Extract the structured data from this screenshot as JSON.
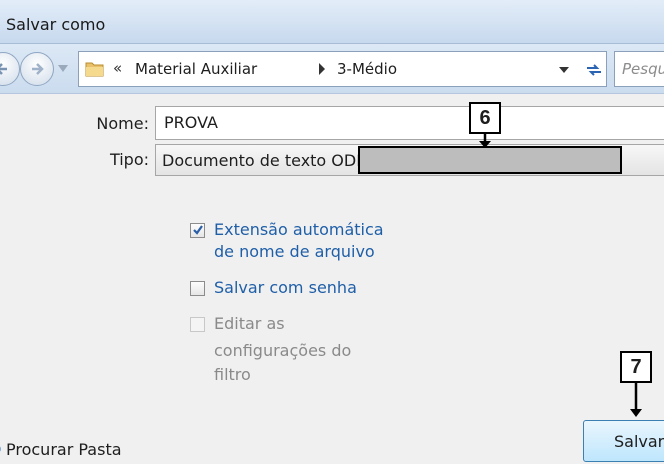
{
  "window": {
    "title": "Salvar como"
  },
  "nav": {
    "address": {
      "chevron": "«",
      "segments": [
        "Material Auxiliar",
        "3-Médio"
      ]
    },
    "search_placeholder": "Pesqu"
  },
  "form": {
    "name_label": "Nome:",
    "name_value": "PROVA",
    "type_label": "Tipo:",
    "type_value": "Documento de texto ODF"
  },
  "options": {
    "auto_ext_line1": "Extensão automática",
    "auto_ext_line2": "de nome de arquivo",
    "auto_ext_checked": true,
    "password_label": "Salvar com senha",
    "password_checked": false,
    "filter_line1": "Editar as",
    "filter_line2": "configurações do",
    "filter_line3": "filtro",
    "filter_enabled": false
  },
  "footer": {
    "browse_label": "Procurar Pasta",
    "save_label": "Salvar"
  },
  "callouts": {
    "first": "6",
    "second": "7"
  },
  "colors": {
    "link_blue": "#1f5fa8",
    "titlebar": "#c7d9ee",
    "button": "#bee6fd"
  }
}
